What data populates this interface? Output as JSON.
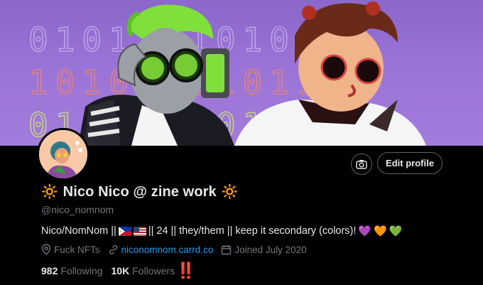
{
  "profile": {
    "sun_left": "🔆",
    "display_name": "Nico Nico @ zine work",
    "sun_right": "🔆",
    "handle": "@nico_nomnom",
    "bio": {
      "text_start": "Nico/NomNom ||",
      "text_mid": "|| 24 || they/them || keep it secondary (colors)!",
      "hearts": [
        "💜",
        "🧡",
        "💚"
      ]
    },
    "location": "Fuck NFTs",
    "website": "niconomnom.carrd.co",
    "joined": "Joined July 2020",
    "following_count": "982",
    "following_label": "Following",
    "followers_count": "10K",
    "followers_label": "Followers",
    "followers_emoji": "‼️"
  },
  "buttons": {
    "edit_profile": "Edit profile"
  },
  "banner": {
    "binary_row_1": "0101101010110",
    "binary_row_2": "1010010101101",
    "binary_row_3": "0101101010010"
  },
  "colors": {
    "accent": "#1d9bf0",
    "muted": "#71767b",
    "text": "#e7e9ea",
    "banner": "#9a73d6"
  },
  "icons": {
    "location": "location-pin-icon",
    "link": "link-icon",
    "calendar": "calendar-icon",
    "camera": "camera-icon",
    "flag_1": "philippines-flag-icon",
    "flag_2": "usa-flag-icon"
  }
}
